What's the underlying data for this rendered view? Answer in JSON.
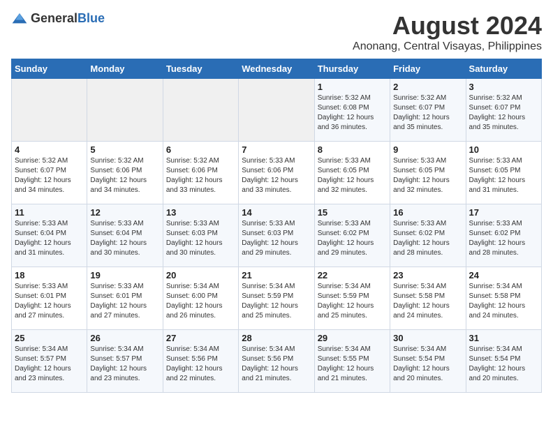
{
  "logo": {
    "general": "General",
    "blue": "Blue"
  },
  "title": "August 2024",
  "subtitle": "Anonang, Central Visayas, Philippines",
  "days_of_week": [
    "Sunday",
    "Monday",
    "Tuesday",
    "Wednesday",
    "Thursday",
    "Friday",
    "Saturday"
  ],
  "weeks": [
    [
      {
        "day": "",
        "empty": true
      },
      {
        "day": "",
        "empty": true
      },
      {
        "day": "",
        "empty": true
      },
      {
        "day": "",
        "empty": true
      },
      {
        "day": "1",
        "sunrise": "5:32 AM",
        "sunset": "6:08 PM",
        "daylight": "12 hours and 36 minutes."
      },
      {
        "day": "2",
        "sunrise": "5:32 AM",
        "sunset": "6:07 PM",
        "daylight": "12 hours and 35 minutes."
      },
      {
        "day": "3",
        "sunrise": "5:32 AM",
        "sunset": "6:07 PM",
        "daylight": "12 hours and 35 minutes."
      }
    ],
    [
      {
        "day": "4",
        "sunrise": "5:32 AM",
        "sunset": "6:07 PM",
        "daylight": "12 hours and 34 minutes."
      },
      {
        "day": "5",
        "sunrise": "5:32 AM",
        "sunset": "6:06 PM",
        "daylight": "12 hours and 34 minutes."
      },
      {
        "day": "6",
        "sunrise": "5:32 AM",
        "sunset": "6:06 PM",
        "daylight": "12 hours and 33 minutes."
      },
      {
        "day": "7",
        "sunrise": "5:33 AM",
        "sunset": "6:06 PM",
        "daylight": "12 hours and 33 minutes."
      },
      {
        "day": "8",
        "sunrise": "5:33 AM",
        "sunset": "6:05 PM",
        "daylight": "12 hours and 32 minutes."
      },
      {
        "day": "9",
        "sunrise": "5:33 AM",
        "sunset": "6:05 PM",
        "daylight": "12 hours and 32 minutes."
      },
      {
        "day": "10",
        "sunrise": "5:33 AM",
        "sunset": "6:05 PM",
        "daylight": "12 hours and 31 minutes."
      }
    ],
    [
      {
        "day": "11",
        "sunrise": "5:33 AM",
        "sunset": "6:04 PM",
        "daylight": "12 hours and 31 minutes."
      },
      {
        "day": "12",
        "sunrise": "5:33 AM",
        "sunset": "6:04 PM",
        "daylight": "12 hours and 30 minutes."
      },
      {
        "day": "13",
        "sunrise": "5:33 AM",
        "sunset": "6:03 PM",
        "daylight": "12 hours and 30 minutes."
      },
      {
        "day": "14",
        "sunrise": "5:33 AM",
        "sunset": "6:03 PM",
        "daylight": "12 hours and 29 minutes."
      },
      {
        "day": "15",
        "sunrise": "5:33 AM",
        "sunset": "6:02 PM",
        "daylight": "12 hours and 29 minutes."
      },
      {
        "day": "16",
        "sunrise": "5:33 AM",
        "sunset": "6:02 PM",
        "daylight": "12 hours and 28 minutes."
      },
      {
        "day": "17",
        "sunrise": "5:33 AM",
        "sunset": "6:02 PM",
        "daylight": "12 hours and 28 minutes."
      }
    ],
    [
      {
        "day": "18",
        "sunrise": "5:33 AM",
        "sunset": "6:01 PM",
        "daylight": "12 hours and 27 minutes."
      },
      {
        "day": "19",
        "sunrise": "5:33 AM",
        "sunset": "6:01 PM",
        "daylight": "12 hours and 27 minutes."
      },
      {
        "day": "20",
        "sunrise": "5:34 AM",
        "sunset": "6:00 PM",
        "daylight": "12 hours and 26 minutes."
      },
      {
        "day": "21",
        "sunrise": "5:34 AM",
        "sunset": "5:59 PM",
        "daylight": "12 hours and 25 minutes."
      },
      {
        "day": "22",
        "sunrise": "5:34 AM",
        "sunset": "5:59 PM",
        "daylight": "12 hours and 25 minutes."
      },
      {
        "day": "23",
        "sunrise": "5:34 AM",
        "sunset": "5:58 PM",
        "daylight": "12 hours and 24 minutes."
      },
      {
        "day": "24",
        "sunrise": "5:34 AM",
        "sunset": "5:58 PM",
        "daylight": "12 hours and 24 minutes."
      }
    ],
    [
      {
        "day": "25",
        "sunrise": "5:34 AM",
        "sunset": "5:57 PM",
        "daylight": "12 hours and 23 minutes."
      },
      {
        "day": "26",
        "sunrise": "5:34 AM",
        "sunset": "5:57 PM",
        "daylight": "12 hours and 23 minutes."
      },
      {
        "day": "27",
        "sunrise": "5:34 AM",
        "sunset": "5:56 PM",
        "daylight": "12 hours and 22 minutes."
      },
      {
        "day": "28",
        "sunrise": "5:34 AM",
        "sunset": "5:56 PM",
        "daylight": "12 hours and 21 minutes."
      },
      {
        "day": "29",
        "sunrise": "5:34 AM",
        "sunset": "5:55 PM",
        "daylight": "12 hours and 21 minutes."
      },
      {
        "day": "30",
        "sunrise": "5:34 AM",
        "sunset": "5:54 PM",
        "daylight": "12 hours and 20 minutes."
      },
      {
        "day": "31",
        "sunrise": "5:34 AM",
        "sunset": "5:54 PM",
        "daylight": "12 hours and 20 minutes."
      }
    ]
  ],
  "labels": {
    "sunrise": "Sunrise:",
    "sunset": "Sunset:",
    "daylight": "Daylight:"
  }
}
